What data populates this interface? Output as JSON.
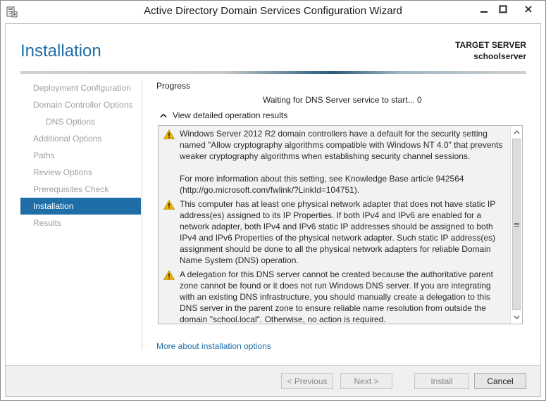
{
  "window": {
    "title": "Active Directory Domain Services Configuration Wizard",
    "minimize_icon": "minimize-icon",
    "maximize_icon": "maximize-icon",
    "close_icon": "close-icon"
  },
  "header": {
    "page_title": "Installation",
    "target_server_label": "TARGET SERVER",
    "target_server_name": "schoolserver"
  },
  "nav": {
    "items": [
      {
        "label": "Deployment Configuration",
        "level": 0,
        "state": "disabled"
      },
      {
        "label": "Domain Controller Options",
        "level": 0,
        "state": "disabled"
      },
      {
        "label": "DNS Options",
        "level": 1,
        "state": "disabled"
      },
      {
        "label": "Additional Options",
        "level": 0,
        "state": "disabled"
      },
      {
        "label": "Paths",
        "level": 0,
        "state": "disabled"
      },
      {
        "label": "Review Options",
        "level": 0,
        "state": "disabled"
      },
      {
        "label": "Prerequisites Check",
        "level": 0,
        "state": "disabled"
      },
      {
        "label": "Installation",
        "level": 0,
        "state": "active"
      },
      {
        "label": "Results",
        "level": 0,
        "state": "disabled"
      }
    ]
  },
  "main": {
    "progress_label": "Progress",
    "status_text": "Waiting for DNS Server service to start... 0",
    "details_toggle_label": "View detailed operation results",
    "messages": [
      {
        "icon": "warning-icon",
        "paragraphs": [
          "Windows Server 2012 R2 domain controllers have a default for the security setting named \"Allow cryptography algorithms compatible with Windows NT 4.0\" that prevents weaker cryptography algorithms when establishing security channel sessions.",
          "For more information about this setting, see Knowledge Base article 942564 (http://go.microsoft.com/fwlink/?LinkId=104751)."
        ]
      },
      {
        "icon": "warning-icon",
        "paragraphs": [
          "This computer has at least one physical network adapter that does not have static IP address(es) assigned to its IP Properties. If both IPv4 and IPv6 are enabled for a network adapter, both IPv4 and IPv6 static IP addresses should be assigned to both IPv4 and IPv6 Properties of the physical network adapter. Such static IP address(es) assignment should be done to all the physical network adapters for reliable Domain Name System (DNS) operation."
        ]
      },
      {
        "icon": "warning-icon",
        "paragraphs": [
          "A delegation for this DNS server cannot be created because the authoritative parent zone cannot be found or it does not run Windows DNS server. If you are integrating with an existing DNS infrastructure, you should manually create a delegation to this DNS server in the parent zone to ensure reliable name resolution from outside the domain \"school.local\". Otherwise, no action is required."
        ]
      }
    ],
    "more_link": "More about installation options"
  },
  "footer": {
    "previous_label": "< Previous",
    "next_label": "Next >",
    "install_label": "Install",
    "cancel_label": "Cancel"
  },
  "colors": {
    "accent": "#1f6ea8",
    "nav_disabled": "#a0a0a0",
    "warning": "#f0b400",
    "footer_bg": "#f0f0f0"
  }
}
